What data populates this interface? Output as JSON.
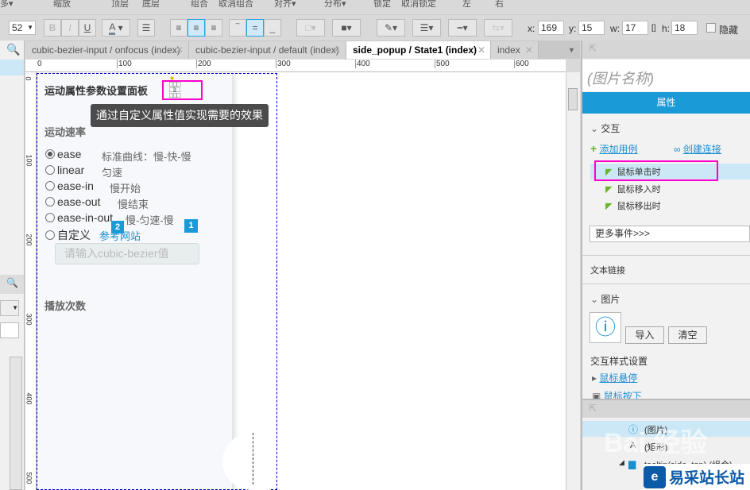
{
  "menu": [
    "多▾",
    "缩放",
    "顶层",
    "底层",
    "组合",
    "取消组合",
    "对齐▾",
    "分布▾",
    "锁定",
    "取消锁定",
    "左",
    "右"
  ],
  "toolbar": {
    "font_size": "52",
    "bold": "B",
    "italic": "I",
    "underline": "U",
    "font_color": "A",
    "x_label": "x:",
    "x": "169",
    "y_label": "y:",
    "y": "15",
    "w_label": "w:",
    "w": "17",
    "h_label": "h:",
    "h": "18",
    "hidden_label": "隐藏"
  },
  "tabs": [
    {
      "label": "cubic-bezier-input / onfocus (index)"
    },
    {
      "label": "cubic-bezier-input / default (index)"
    },
    {
      "label": "side_popup / State1 (index)"
    },
    {
      "label": "index"
    }
  ],
  "ruler": {
    "h": [
      "0",
      "100",
      "200",
      "300",
      "400",
      "500",
      "600"
    ],
    "v": [
      "0",
      "100",
      "200",
      "300",
      "400",
      "500"
    ]
  },
  "canvas": {
    "panel_title": "运动属性参数设置面板",
    "tooltip": "通过自定义属性值实现需要的效果",
    "speed_title": "运动速率",
    "options": [
      {
        "label": "ease",
        "desc": "标准曲线：慢-快-慢",
        "selected": true
      },
      {
        "label": "linear",
        "desc": "匀速",
        "selected": false
      },
      {
        "label": "ease-in",
        "desc": "慢开始",
        "selected": false
      },
      {
        "label": "ease-out",
        "desc": "慢结束",
        "selected": false
      },
      {
        "label": "ease-in-out",
        "desc": "慢-匀速-慢",
        "selected": false
      },
      {
        "label": "自定义",
        "desc": "参考网站",
        "selected": false
      }
    ],
    "badge1": "1",
    "badge2": "2",
    "input_placeholder": "请输入cubic-bezier值",
    "play_title": "播放次数"
  },
  "inspector": {
    "name_placeholder": "(图片名称)",
    "tab": "属性",
    "interaction": "交互",
    "add_case": "添加用例",
    "create_link": "创建连接",
    "events": [
      "鼠标单击时",
      "鼠标移入时",
      "鼠标移出时"
    ],
    "more_events": "更多事件>>>",
    "text_link": "文本链接",
    "image": "图片",
    "import": "导入",
    "clear": "清空",
    "style_title": "交互样式设置",
    "hover": "鼠标悬停",
    "pressed": "鼠标按下"
  },
  "outline": {
    "items": [
      "(图片)",
      "(矩形)",
      "tooltip(side_top) (组合)"
    ]
  },
  "watermark": {
    "text": "易采站长站",
    "baidu": "Bai 经验"
  },
  "colors": {
    "accent": "#1a9ad6",
    "highlight": "#ff00cc",
    "selected_row": "#cce8f6"
  }
}
